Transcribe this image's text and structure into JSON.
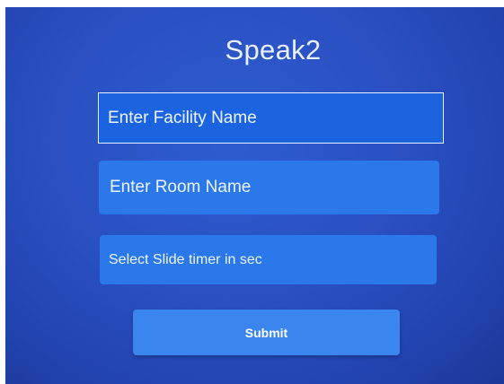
{
  "app": {
    "title": "Speak2"
  },
  "form": {
    "facility_placeholder": "Enter Facility Name",
    "room_placeholder": "Enter Room Name",
    "timer_placeholder": "Select Slide timer in sec",
    "submit_label": "Submit"
  },
  "colors": {
    "background": "#2a50c2",
    "field": "#2a78ea",
    "button": "#3a86ee",
    "text": "#eef4ff"
  }
}
